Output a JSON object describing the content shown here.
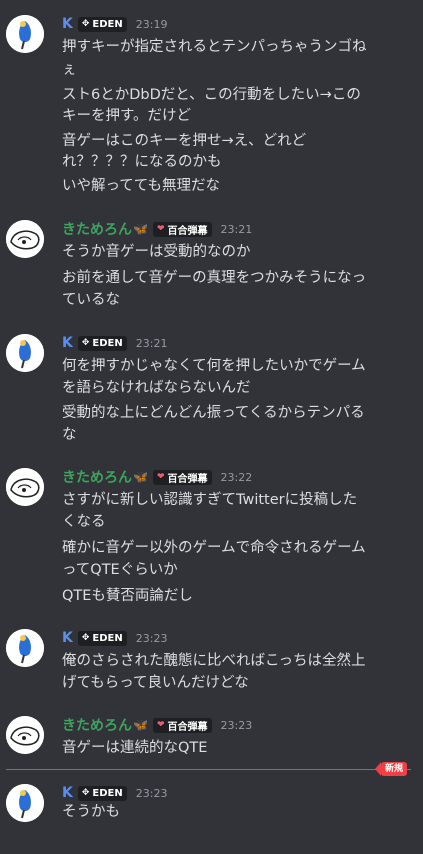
{
  "users": {
    "k": {
      "name": "K",
      "tag": "EDEN",
      "tag_icon": "diamond-cross-icon"
    },
    "kitame": {
      "name": "きためろん",
      "emoji": "🦋",
      "tag": "百合弾幕",
      "tag_icon": "heart-icon"
    }
  },
  "messages": [
    {
      "user": "K",
      "tag": "EDEN",
      "time": "23:19",
      "lines": [
        "押すキーが指定されるとテンパっちゃうンゴね",
        "ぇ",
        "スト6とかDbDだと、この行動をしたい→この",
        "キーを押す。だけど",
        "音ゲーはこのキーを押せ→え、どれど",
        "れ？？？？になるのかも",
        "いや解ってても無理だな"
      ]
    },
    {
      "user": "きためろん",
      "tag": "百合弾幕",
      "time": "23:21",
      "lines": [
        "そうか音ゲーは受動的なのか",
        "お前を通して音ゲーの真理をつかみそうになっ",
        "ているな"
      ]
    },
    {
      "user": "K",
      "tag": "EDEN",
      "time": "23:21",
      "lines": [
        "何を押すかじゃなくて何を押したいかでゲーム",
        "を語らなければならないんだ",
        "受動的な上にどんどん振ってくるからテンパる",
        "な"
      ]
    },
    {
      "user": "きためろん",
      "tag": "百合弾幕",
      "time": "23:22",
      "lines": [
        "さすがに新しい認識すぎてTwitterに投稿した",
        "くなる",
        "確かに音ゲー以外のゲームで命令されるゲーム",
        "ってQTEぐらいか",
        "QTEも賛否両論だし"
      ]
    },
    {
      "user": "K",
      "tag": "EDEN",
      "time": "23:23",
      "lines": [
        "俺のさらされた醜態に比べればこっちは全然上",
        "げてもらって良いんだけどな"
      ]
    },
    {
      "user": "きためろん",
      "tag": "百合弾幕",
      "time": "23:23",
      "lines": [
        "音ゲーは連続的なQTE"
      ]
    },
    {
      "user": "K",
      "tag": "EDEN",
      "time": "23:23",
      "lines": [
        "そうかも"
      ]
    }
  ],
  "divider": {
    "label": "新規"
  },
  "colors": {
    "background": "#313338",
    "k_name": "#5c8ef0",
    "kitame_name": "#3ba55d",
    "new_divider": "#f23f43"
  }
}
